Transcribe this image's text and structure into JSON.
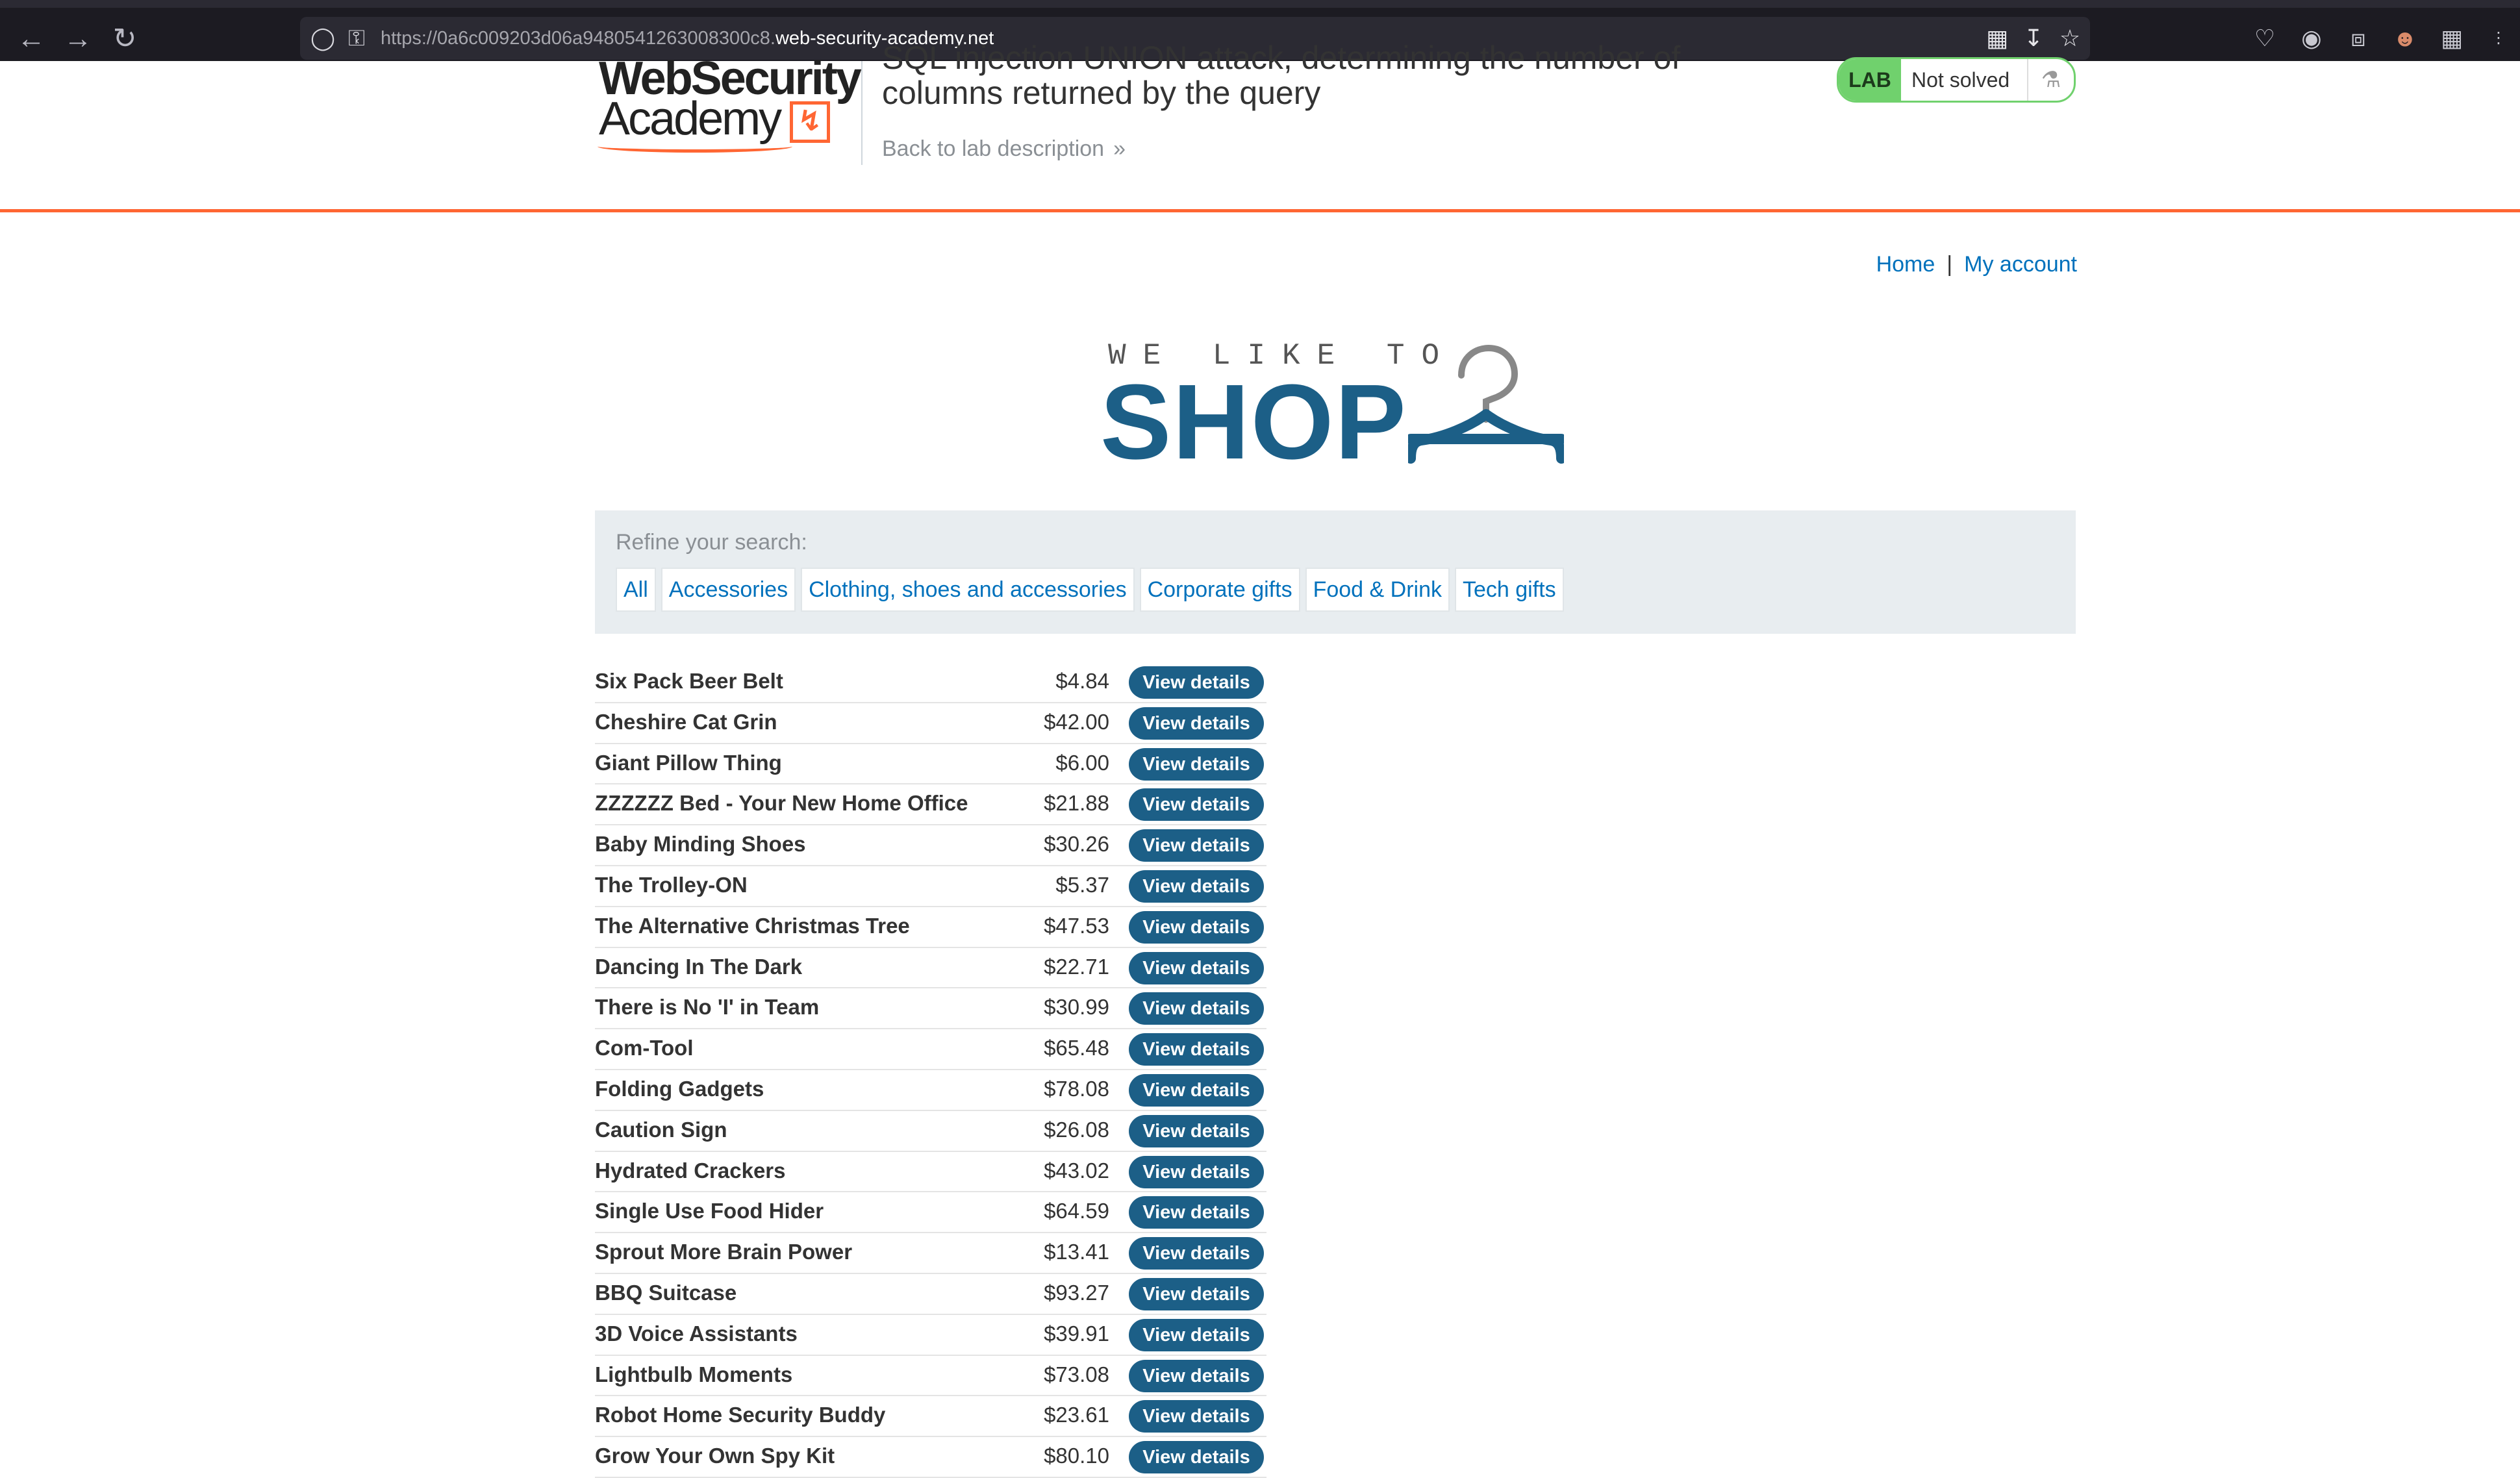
{
  "browser": {
    "url_prefix": "https://0a6c009203d06a9480541263008300c8.",
    "url_host": "web-security-academy.net"
  },
  "header": {
    "logo_line1": "WebSecurity",
    "logo_line2": "Academy",
    "lab_title": "SQL injection UNION attack, determining the number of columns returned by the query",
    "back_link": "Back to lab description",
    "lab_tag": "LAB",
    "lab_state": "Not solved"
  },
  "nav": {
    "home": "Home",
    "separator": "|",
    "account": "My account"
  },
  "banner": {
    "small": "WE LIKE TO",
    "big": "SHOP"
  },
  "filter": {
    "label": "Refine your search:",
    "categories": [
      "All",
      "Accessories",
      "Clothing, shoes and accessories",
      "Corporate gifts",
      "Food & Drink",
      "Tech gifts"
    ]
  },
  "button_label": "View details",
  "products": [
    {
      "name": "Six Pack Beer Belt",
      "price": "$4.84"
    },
    {
      "name": "Cheshire Cat Grin",
      "price": "$42.00"
    },
    {
      "name": "Giant Pillow Thing",
      "price": "$6.00"
    },
    {
      "name": "ZZZZZZ Bed - Your New Home Office",
      "price": "$21.88"
    },
    {
      "name": "Baby Minding Shoes",
      "price": "$30.26"
    },
    {
      "name": "The Trolley-ON",
      "price": "$5.37"
    },
    {
      "name": "The Alternative Christmas Tree",
      "price": "$47.53"
    },
    {
      "name": "Dancing In The Dark",
      "price": "$22.71"
    },
    {
      "name": "There is No 'I' in Team",
      "price": "$30.99"
    },
    {
      "name": "Com-Tool",
      "price": "$65.48"
    },
    {
      "name": "Folding Gadgets",
      "price": "$78.08"
    },
    {
      "name": "Caution Sign",
      "price": "$26.08"
    },
    {
      "name": "Hydrated Crackers",
      "price": "$43.02"
    },
    {
      "name": "Single Use Food Hider",
      "price": "$64.59"
    },
    {
      "name": "Sprout More Brain Power",
      "price": "$13.41"
    },
    {
      "name": "BBQ Suitcase",
      "price": "$93.27"
    },
    {
      "name": "3D Voice Assistants",
      "price": "$39.91"
    },
    {
      "name": "Lightbulb Moments",
      "price": "$73.08"
    },
    {
      "name": "Robot Home Security Buddy",
      "price": "$23.61"
    },
    {
      "name": "Grow Your Own Spy Kit",
      "price": "$80.10"
    }
  ],
  "colors": {
    "accent_orange": "#ff6633",
    "brand_blue": "#1c5f87",
    "link_blue": "#0071bc",
    "lab_green": "#70d16d"
  },
  "icons": [
    "back-arrow-icon",
    "forward-arrow-icon",
    "reload-icon",
    "shield-icon",
    "lock-icon",
    "qr-code-icon",
    "download-icon",
    "bookmark-star-icon",
    "pocket-icon",
    "account-icon",
    "extensions-icon",
    "profile-avatar-icon",
    "grid-icon",
    "flask-icon",
    "hanger-icon",
    "chevron-right-icon"
  ]
}
